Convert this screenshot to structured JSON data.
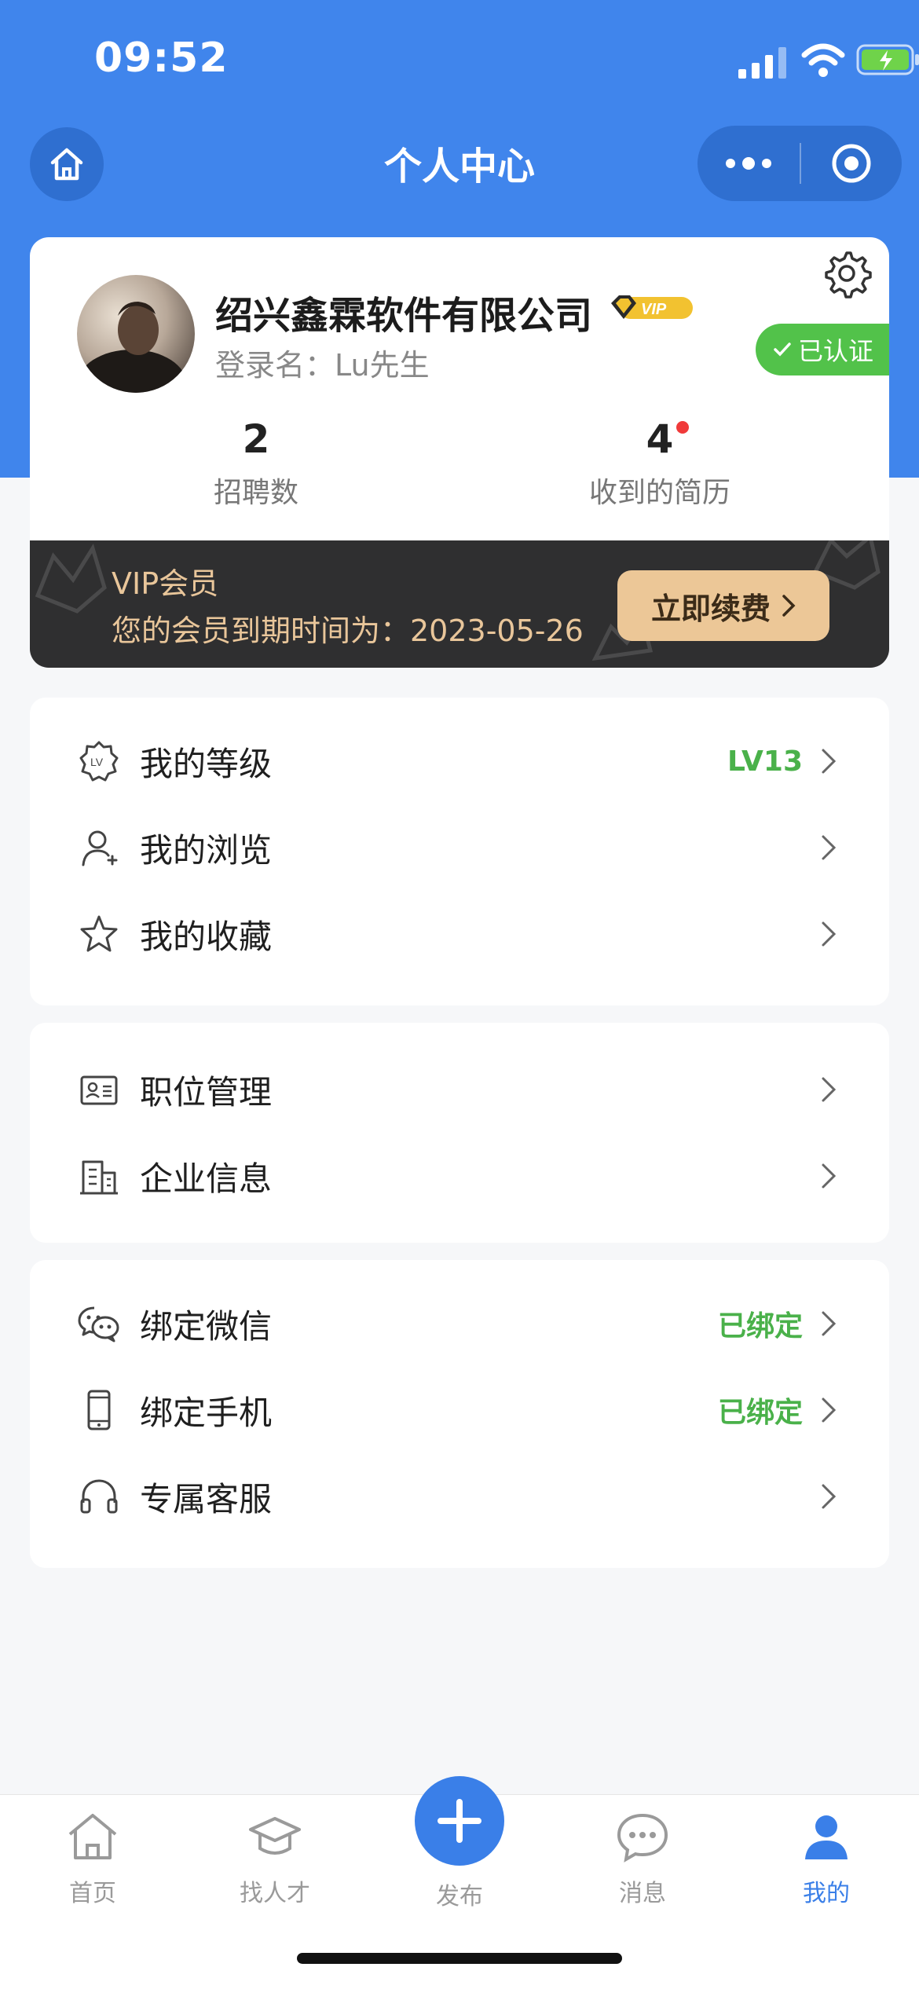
{
  "status_bar": {
    "time": "09:52"
  },
  "nav": {
    "title": "个人中心"
  },
  "profile": {
    "company": "绍兴鑫霖软件有限公司",
    "vip_badge": "VIP",
    "login_name": "登录名：Lu先生",
    "verified_label": "已认证",
    "stats": [
      {
        "value": "2",
        "label": "招聘数"
      },
      {
        "value": "4",
        "label": "收到的简历"
      }
    ]
  },
  "vip": {
    "title": "VIP会员",
    "expire": "您的会员到期时间为：2023-05-26",
    "renew_label": "立即续费"
  },
  "menu": {
    "group1": [
      {
        "label": "我的等级",
        "value": "LV13",
        "icon": "level-icon"
      },
      {
        "label": "我的浏览",
        "value": "",
        "icon": "user-icon"
      },
      {
        "label": "我的收藏",
        "value": "",
        "icon": "star-icon"
      }
    ],
    "group2": [
      {
        "label": "职位管理",
        "value": "",
        "icon": "id-card-icon"
      },
      {
        "label": "企业信息",
        "value": "",
        "icon": "building-icon"
      }
    ],
    "group3": [
      {
        "label": "绑定微信",
        "value": "已绑定",
        "icon": "wechat-icon"
      },
      {
        "label": "绑定手机",
        "value": "已绑定",
        "icon": "phone-icon"
      },
      {
        "label": "专属客服",
        "value": "",
        "icon": "headset-icon"
      }
    ]
  },
  "tabbar": {
    "home": "首页",
    "talent": "找人才",
    "publish": "发布",
    "messages": "消息",
    "mine": "我的"
  },
  "colors": {
    "primary": "#4085ec",
    "accent_green": "#4ab14a",
    "vip_gold": "#e9c69a",
    "tab_active": "#3a7fe8"
  }
}
